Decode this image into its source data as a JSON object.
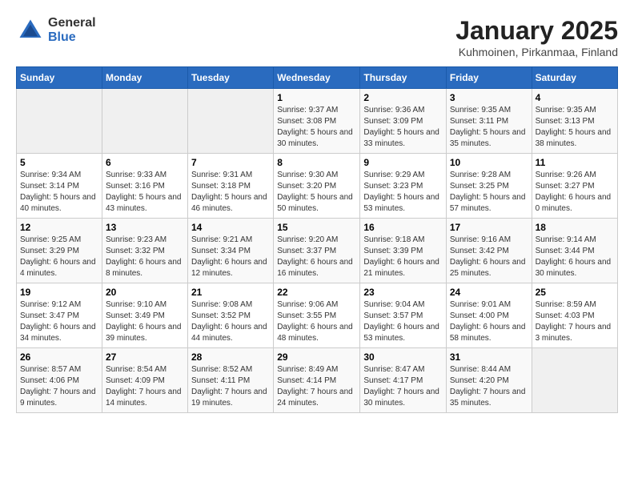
{
  "header": {
    "logo_general": "General",
    "logo_blue": "Blue",
    "title": "January 2025",
    "subtitle": "Kuhmoinen, Pirkanmaa, Finland"
  },
  "weekdays": [
    "Sunday",
    "Monday",
    "Tuesday",
    "Wednesday",
    "Thursday",
    "Friday",
    "Saturday"
  ],
  "weeks": [
    [
      {
        "day": "",
        "sunrise": "",
        "sunset": "",
        "daylight": ""
      },
      {
        "day": "",
        "sunrise": "",
        "sunset": "",
        "daylight": ""
      },
      {
        "day": "",
        "sunrise": "",
        "sunset": "",
        "daylight": ""
      },
      {
        "day": "1",
        "sunrise": "Sunrise: 9:37 AM",
        "sunset": "Sunset: 3:08 PM",
        "daylight": "Daylight: 5 hours and 30 minutes."
      },
      {
        "day": "2",
        "sunrise": "Sunrise: 9:36 AM",
        "sunset": "Sunset: 3:09 PM",
        "daylight": "Daylight: 5 hours and 33 minutes."
      },
      {
        "day": "3",
        "sunrise": "Sunrise: 9:35 AM",
        "sunset": "Sunset: 3:11 PM",
        "daylight": "Daylight: 5 hours and 35 minutes."
      },
      {
        "day": "4",
        "sunrise": "Sunrise: 9:35 AM",
        "sunset": "Sunset: 3:13 PM",
        "daylight": "Daylight: 5 hours and 38 minutes."
      }
    ],
    [
      {
        "day": "5",
        "sunrise": "Sunrise: 9:34 AM",
        "sunset": "Sunset: 3:14 PM",
        "daylight": "Daylight: 5 hours and 40 minutes."
      },
      {
        "day": "6",
        "sunrise": "Sunrise: 9:33 AM",
        "sunset": "Sunset: 3:16 PM",
        "daylight": "Daylight: 5 hours and 43 minutes."
      },
      {
        "day": "7",
        "sunrise": "Sunrise: 9:31 AM",
        "sunset": "Sunset: 3:18 PM",
        "daylight": "Daylight: 5 hours and 46 minutes."
      },
      {
        "day": "8",
        "sunrise": "Sunrise: 9:30 AM",
        "sunset": "Sunset: 3:20 PM",
        "daylight": "Daylight: 5 hours and 50 minutes."
      },
      {
        "day": "9",
        "sunrise": "Sunrise: 9:29 AM",
        "sunset": "Sunset: 3:23 PM",
        "daylight": "Daylight: 5 hours and 53 minutes."
      },
      {
        "day": "10",
        "sunrise": "Sunrise: 9:28 AM",
        "sunset": "Sunset: 3:25 PM",
        "daylight": "Daylight: 5 hours and 57 minutes."
      },
      {
        "day": "11",
        "sunrise": "Sunrise: 9:26 AM",
        "sunset": "Sunset: 3:27 PM",
        "daylight": "Daylight: 6 hours and 0 minutes."
      }
    ],
    [
      {
        "day": "12",
        "sunrise": "Sunrise: 9:25 AM",
        "sunset": "Sunset: 3:29 PM",
        "daylight": "Daylight: 6 hours and 4 minutes."
      },
      {
        "day": "13",
        "sunrise": "Sunrise: 9:23 AM",
        "sunset": "Sunset: 3:32 PM",
        "daylight": "Daylight: 6 hours and 8 minutes."
      },
      {
        "day": "14",
        "sunrise": "Sunrise: 9:21 AM",
        "sunset": "Sunset: 3:34 PM",
        "daylight": "Daylight: 6 hours and 12 minutes."
      },
      {
        "day": "15",
        "sunrise": "Sunrise: 9:20 AM",
        "sunset": "Sunset: 3:37 PM",
        "daylight": "Daylight: 6 hours and 16 minutes."
      },
      {
        "day": "16",
        "sunrise": "Sunrise: 9:18 AM",
        "sunset": "Sunset: 3:39 PM",
        "daylight": "Daylight: 6 hours and 21 minutes."
      },
      {
        "day": "17",
        "sunrise": "Sunrise: 9:16 AM",
        "sunset": "Sunset: 3:42 PM",
        "daylight": "Daylight: 6 hours and 25 minutes."
      },
      {
        "day": "18",
        "sunrise": "Sunrise: 9:14 AM",
        "sunset": "Sunset: 3:44 PM",
        "daylight": "Daylight: 6 hours and 30 minutes."
      }
    ],
    [
      {
        "day": "19",
        "sunrise": "Sunrise: 9:12 AM",
        "sunset": "Sunset: 3:47 PM",
        "daylight": "Daylight: 6 hours and 34 minutes."
      },
      {
        "day": "20",
        "sunrise": "Sunrise: 9:10 AM",
        "sunset": "Sunset: 3:49 PM",
        "daylight": "Daylight: 6 hours and 39 minutes."
      },
      {
        "day": "21",
        "sunrise": "Sunrise: 9:08 AM",
        "sunset": "Sunset: 3:52 PM",
        "daylight": "Daylight: 6 hours and 44 minutes."
      },
      {
        "day": "22",
        "sunrise": "Sunrise: 9:06 AM",
        "sunset": "Sunset: 3:55 PM",
        "daylight": "Daylight: 6 hours and 48 minutes."
      },
      {
        "day": "23",
        "sunrise": "Sunrise: 9:04 AM",
        "sunset": "Sunset: 3:57 PM",
        "daylight": "Daylight: 6 hours and 53 minutes."
      },
      {
        "day": "24",
        "sunrise": "Sunrise: 9:01 AM",
        "sunset": "Sunset: 4:00 PM",
        "daylight": "Daylight: 6 hours and 58 minutes."
      },
      {
        "day": "25",
        "sunrise": "Sunrise: 8:59 AM",
        "sunset": "Sunset: 4:03 PM",
        "daylight": "Daylight: 7 hours and 3 minutes."
      }
    ],
    [
      {
        "day": "26",
        "sunrise": "Sunrise: 8:57 AM",
        "sunset": "Sunset: 4:06 PM",
        "daylight": "Daylight: 7 hours and 9 minutes."
      },
      {
        "day": "27",
        "sunrise": "Sunrise: 8:54 AM",
        "sunset": "Sunset: 4:09 PM",
        "daylight": "Daylight: 7 hours and 14 minutes."
      },
      {
        "day": "28",
        "sunrise": "Sunrise: 8:52 AM",
        "sunset": "Sunset: 4:11 PM",
        "daylight": "Daylight: 7 hours and 19 minutes."
      },
      {
        "day": "29",
        "sunrise": "Sunrise: 8:49 AM",
        "sunset": "Sunset: 4:14 PM",
        "daylight": "Daylight: 7 hours and 24 minutes."
      },
      {
        "day": "30",
        "sunrise": "Sunrise: 8:47 AM",
        "sunset": "Sunset: 4:17 PM",
        "daylight": "Daylight: 7 hours and 30 minutes."
      },
      {
        "day": "31",
        "sunrise": "Sunrise: 8:44 AM",
        "sunset": "Sunset: 4:20 PM",
        "daylight": "Daylight: 7 hours and 35 minutes."
      },
      {
        "day": "",
        "sunrise": "",
        "sunset": "",
        "daylight": ""
      }
    ]
  ]
}
